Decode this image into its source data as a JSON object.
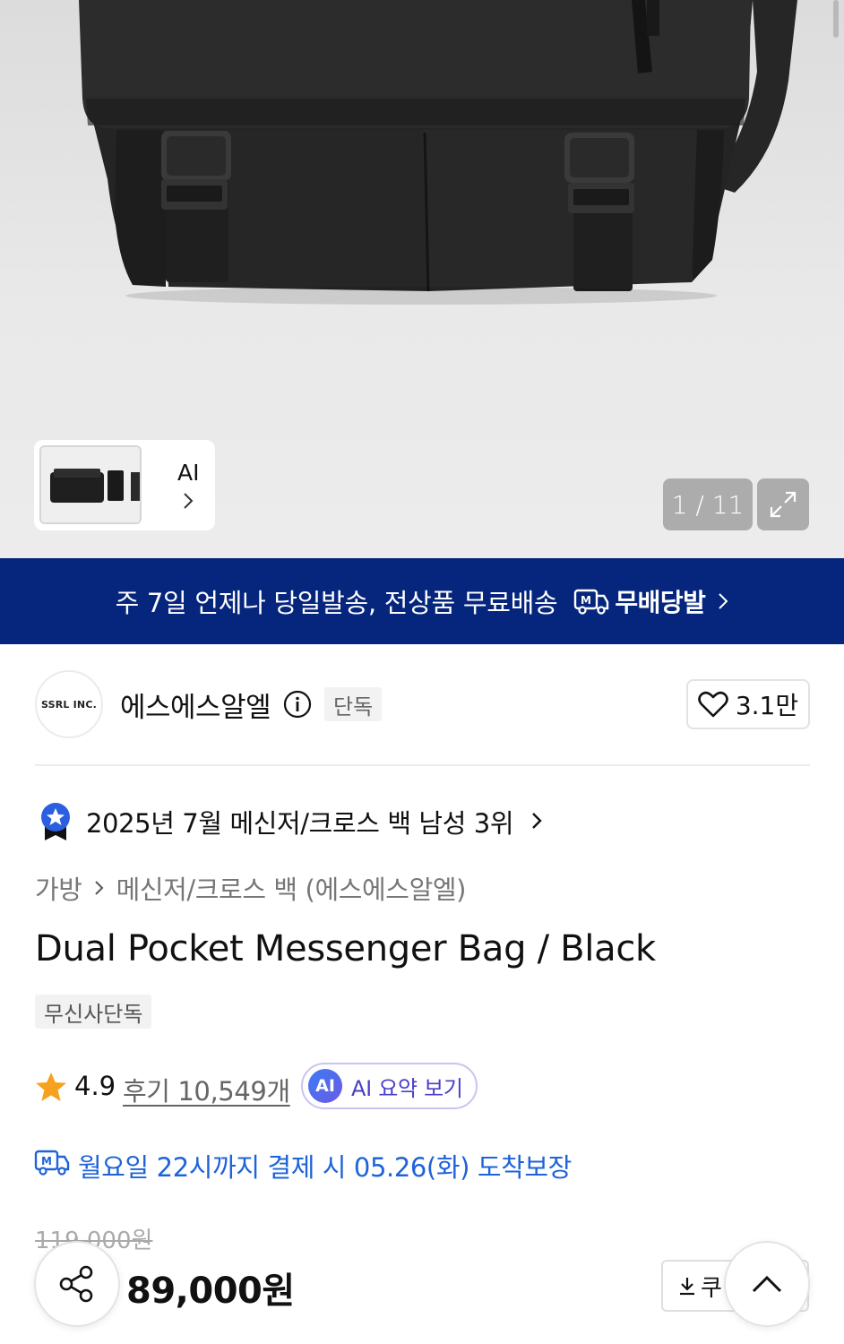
{
  "gallery": {
    "thumbnail_ai_label": "AI",
    "counter": "1 / 11"
  },
  "banner": {
    "text": "주 7일 언제나 당일발송, 전상품 무료배송",
    "brand": "무배당발"
  },
  "brand": {
    "logo_text": "SSRL INC.",
    "name": "에스에스알엘",
    "tag": "단독",
    "likes": "3.1만"
  },
  "ranking": {
    "text": "2025년 7월 메신저/크로스 백 남성 3위"
  },
  "breadcrumb": {
    "category": "가방",
    "subcategory": "메신저/크로스 백 (에스에스알엘)"
  },
  "product": {
    "title": "Dual Pocket Messenger Bag / Black",
    "exclusive_tag": "무신사단독",
    "rating": "4.9",
    "reviews": "후기 10,549개",
    "ai_summary_badge": "AI",
    "ai_summary_label": "AI 요약 보기",
    "delivery": "월요일 22시까지 결제 시 05.26(화) 도착보장",
    "original_price": "119,000원",
    "price": "89,000원",
    "coupon_label": "쿠"
  },
  "colors": {
    "banner_bg": "#06267d",
    "delivery_text": "#1e63d8",
    "ai_purple": "#4a3fc7",
    "star": "#f6a21e"
  }
}
